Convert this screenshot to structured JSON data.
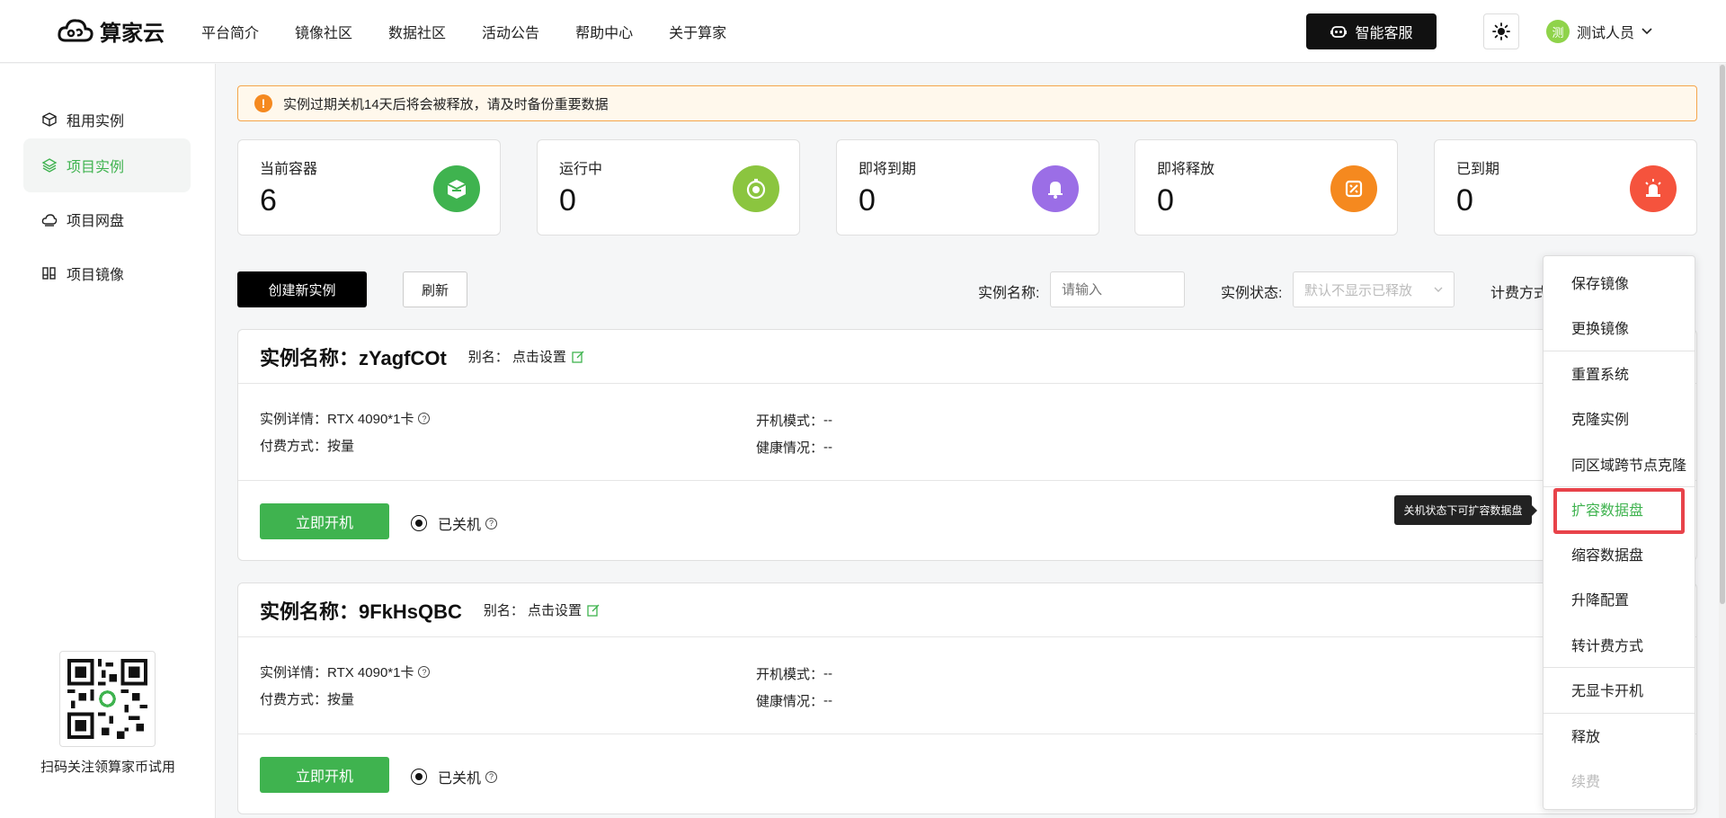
{
  "header": {
    "logo_text": "算家云",
    "nav": [
      "平台简介",
      "镜像社区",
      "数据社区",
      "活动公告",
      "帮助中心",
      "关于算家"
    ],
    "service_label": "智能客服",
    "user": {
      "avatar_char": "测",
      "name": "测试人员"
    }
  },
  "sidebar": {
    "items": [
      "租用实例",
      "项目实例",
      "项目网盘",
      "项目镜像"
    ],
    "active": "项目实例",
    "qr_caption": "扫码关注领算家币试用"
  },
  "notice": "实例过期关机14天后将会被释放，请及时备份重要数据",
  "stats": [
    {
      "label": "当前容器",
      "value": "6",
      "color": "#3fb34f"
    },
    {
      "label": "运行中",
      "value": "0",
      "color": "#8bc53f"
    },
    {
      "label": "即将到期",
      "value": "0",
      "color": "#9b6ee6"
    },
    {
      "label": "即将释放",
      "value": "0",
      "color": "#f5891f"
    },
    {
      "label": "已到期",
      "value": "0",
      "color": "#f5533d"
    }
  ],
  "toolbar": {
    "create_label": "创建新实例",
    "refresh_label": "刷新",
    "name_label": "实例名称:",
    "name_placeholder": "请输入",
    "status_label": "实例状态:",
    "status_placeholder": "默认不显示已释放",
    "billing_label": "计费方式"
  },
  "instances": [
    {
      "title": "实例名称：zYagfCOt",
      "alias_label": "别名：",
      "alias_link": "点击设置",
      "detail_label": "实例详情：",
      "detail_value": "RTX 4090*1卡",
      "pay_label": "付费方式：",
      "pay_value": "按量",
      "boot_label": "开机模式：",
      "boot_value": "--",
      "health_label": "健康情况：",
      "health_value": "--",
      "start_label": "立即开机",
      "state_label": "已关机"
    },
    {
      "title": "实例名称：9FkHsQBC",
      "alias_label": "别名：",
      "alias_link": "点击设置",
      "detail_label": "实例详情：",
      "detail_value": "RTX 4090*1卡",
      "pay_label": "付费方式：",
      "pay_value": "按量",
      "boot_label": "开机模式：",
      "boot_value": "--",
      "health_label": "健康情况：",
      "health_value": "--",
      "start_label": "立即开机",
      "state_label": "已关机"
    }
  ],
  "menu": {
    "items": [
      "保存镜像",
      "更换镜像",
      "重置系统",
      "克隆实例",
      "同区域跨节点克隆",
      "扩容数据盘",
      "缩容数据盘",
      "升降配置",
      "转计费方式",
      "无显卡开机",
      "释放",
      "续费"
    ],
    "highlighted": "扩容数据盘",
    "disabled": "续费"
  },
  "tooltip": "关机状态下可扩容数据盘",
  "colors": {
    "accent": "#3fb34f",
    "warning": "#f5891f",
    "highlight_border": "#e8434a"
  }
}
